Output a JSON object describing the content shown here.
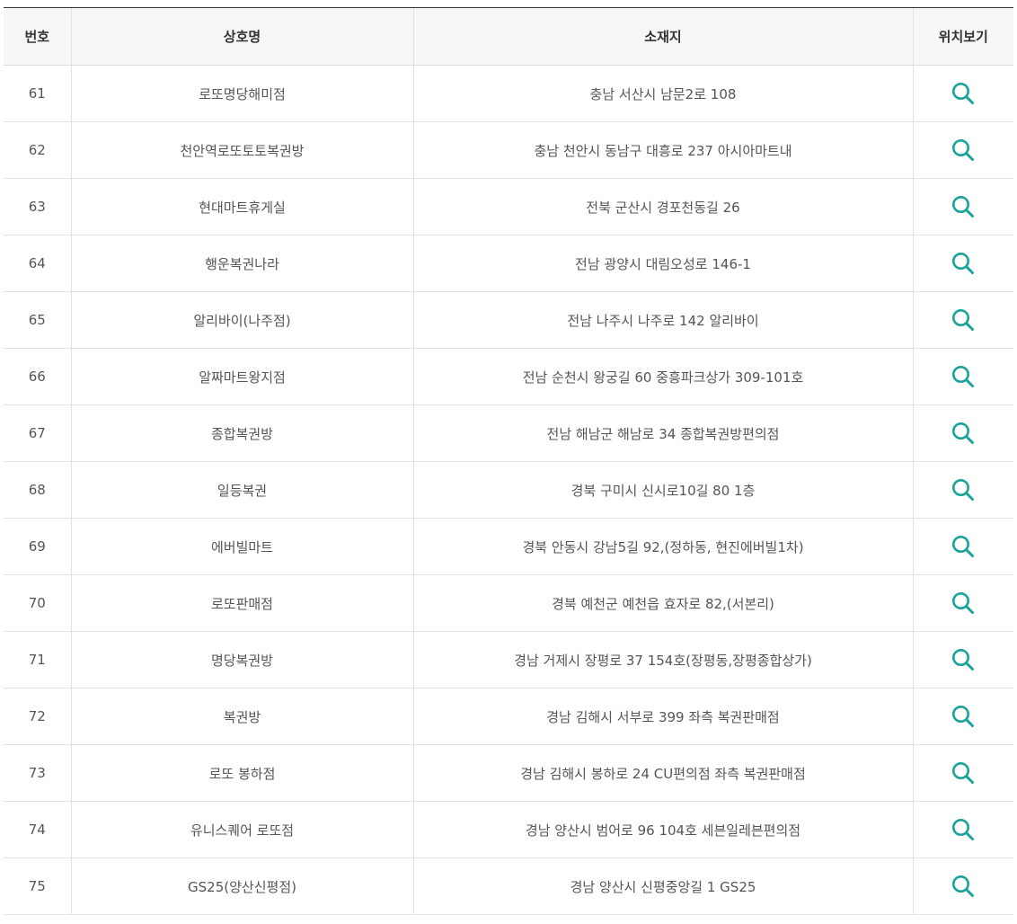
{
  "table": {
    "headers": {
      "no": "번호",
      "name": "상호명",
      "address": "소재지",
      "map": "위치보기"
    },
    "accent_color": "#1aa39a",
    "map_icon": "search-icon",
    "rows": [
      {
        "no": "61",
        "name": "로또명당해미점",
        "address": "충남 서산시 남문2로 108"
      },
      {
        "no": "62",
        "name": "천안역로또토토복권방",
        "address": "충남 천안시 동남구 대흥로 237 아시아마트내"
      },
      {
        "no": "63",
        "name": "현대마트휴게실",
        "address": "전북 군산시 경포천동길 26"
      },
      {
        "no": "64",
        "name": "행운복권나라",
        "address": "전남 광양시 대림오성로 146-1"
      },
      {
        "no": "65",
        "name": "알리바이(나주점)",
        "address": "전남 나주시 나주로 142 알리바이"
      },
      {
        "no": "66",
        "name": "알짜마트왕지점",
        "address": "전남 순천시 왕궁길 60 중흥파크상가 309-101호"
      },
      {
        "no": "67",
        "name": "종합복권방",
        "address": "전남 해남군 해남로 34 종합복권방편의점"
      },
      {
        "no": "68",
        "name": "일등복권",
        "address": "경북 구미시 신시로10길 80 1층"
      },
      {
        "no": "69",
        "name": "에버빌마트",
        "address": "경북 안동시 강남5길 92,(정하동, 현진에버빌1차)"
      },
      {
        "no": "70",
        "name": "로또판매점",
        "address": "경북 예천군 예천읍 효자로 82,(서본리)"
      },
      {
        "no": "71",
        "name": "명당복권방",
        "address": "경남 거제시 장평로 37 154호(장평동,장평종합상가)"
      },
      {
        "no": "72",
        "name": "복권방",
        "address": "경남 김해시 서부로 399 좌측 복권판매점"
      },
      {
        "no": "73",
        "name": "로또 봉하점",
        "address": "경남 김해시 봉하로 24 CU편의점 좌측 복권판매점"
      },
      {
        "no": "74",
        "name": "유니스퀘어 로또점",
        "address": "경남 양산시 범어로 96 104호 세븐일레븐편의점"
      },
      {
        "no": "75",
        "name": "GS25(양산신평점)",
        "address": "경남 양산시 신평중앙길 1 GS25"
      }
    ]
  }
}
